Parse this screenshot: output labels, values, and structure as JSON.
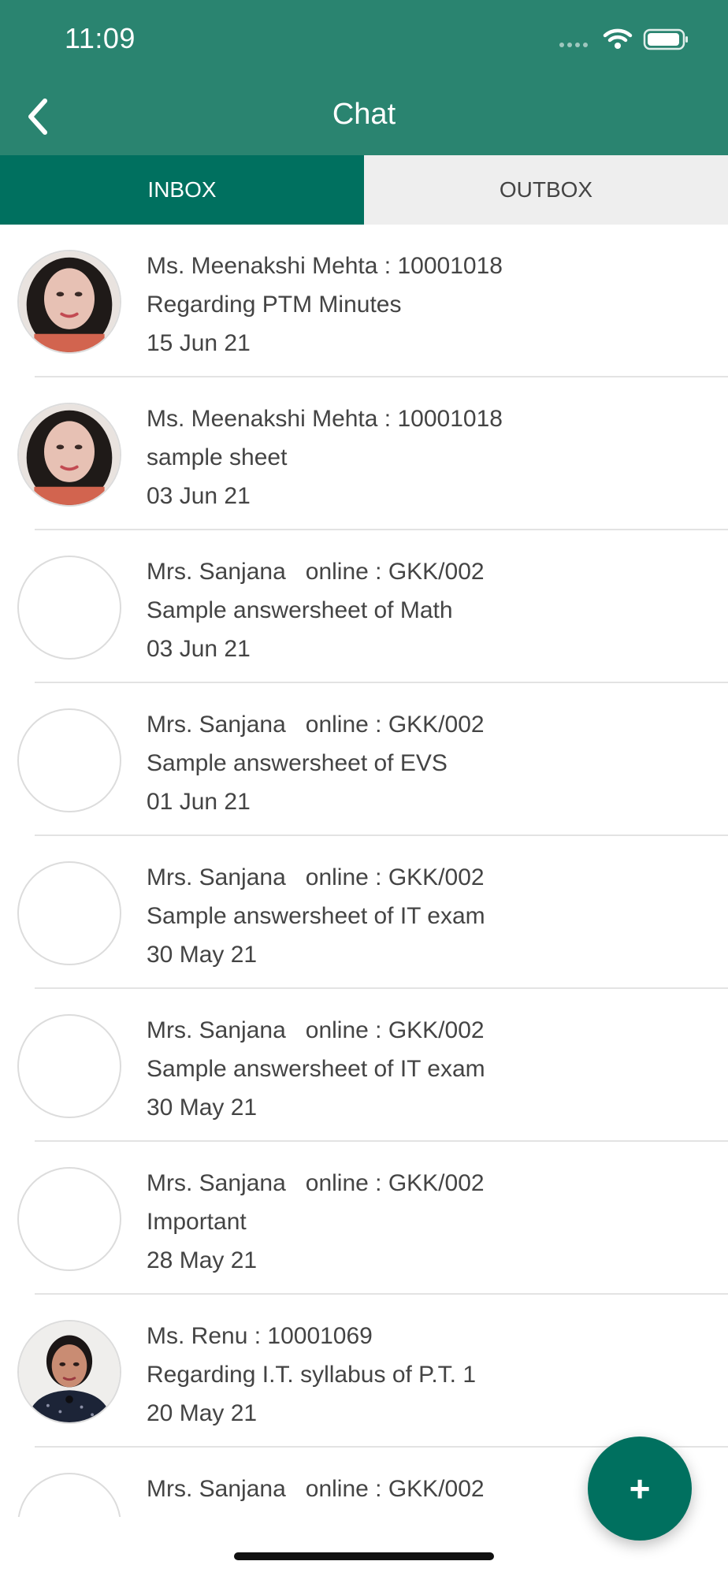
{
  "status_bar": {
    "time": "11:09"
  },
  "header": {
    "title": "Chat",
    "color": "#2a8470"
  },
  "tabs": [
    {
      "label": "INBOX",
      "active": true
    },
    {
      "label": "OUTBOX",
      "active": false
    }
  ],
  "messages": [
    {
      "sender": "Ms. Meenakshi Mehta : 10001018",
      "subject": "Regarding PTM Minutes",
      "date": "15 Jun 21",
      "avatar": "photo-woman-red"
    },
    {
      "sender": "Ms. Meenakshi Mehta : 10001018",
      "subject": "sample sheet",
      "date": "03 Jun 21",
      "avatar": "photo-woman-red"
    },
    {
      "sender": "Mrs. Sanjana   online : GKK/002",
      "subject": "Sample answersheet of Math",
      "date": "03 Jun 21",
      "avatar": "empty"
    },
    {
      "sender": "Mrs. Sanjana   online : GKK/002",
      "subject": "Sample answersheet of EVS",
      "date": "01 Jun 21",
      "avatar": "empty"
    },
    {
      "sender": "Mrs. Sanjana   online : GKK/002",
      "subject": "Sample answersheet of IT exam",
      "date": "30 May 21",
      "avatar": "empty"
    },
    {
      "sender": "Mrs. Sanjana   online : GKK/002",
      "subject": "Sample answersheet of IT exam",
      "date": "30 May 21",
      "avatar": "empty"
    },
    {
      "sender": "Mrs. Sanjana   online : GKK/002",
      "subject": "Important",
      "date": "28 May 21",
      "avatar": "empty"
    },
    {
      "sender": "Ms. Renu : 10001069",
      "subject": "Regarding I.T. syllabus of P.T. 1",
      "date": "20 May 21",
      "avatar": "photo-woman-dark"
    },
    {
      "sender": "Mrs. Sanjana   online : GKK/002",
      "subject": "",
      "date": "",
      "avatar": "empty"
    }
  ],
  "fab": {
    "label": "+",
    "color": "#00705f"
  }
}
